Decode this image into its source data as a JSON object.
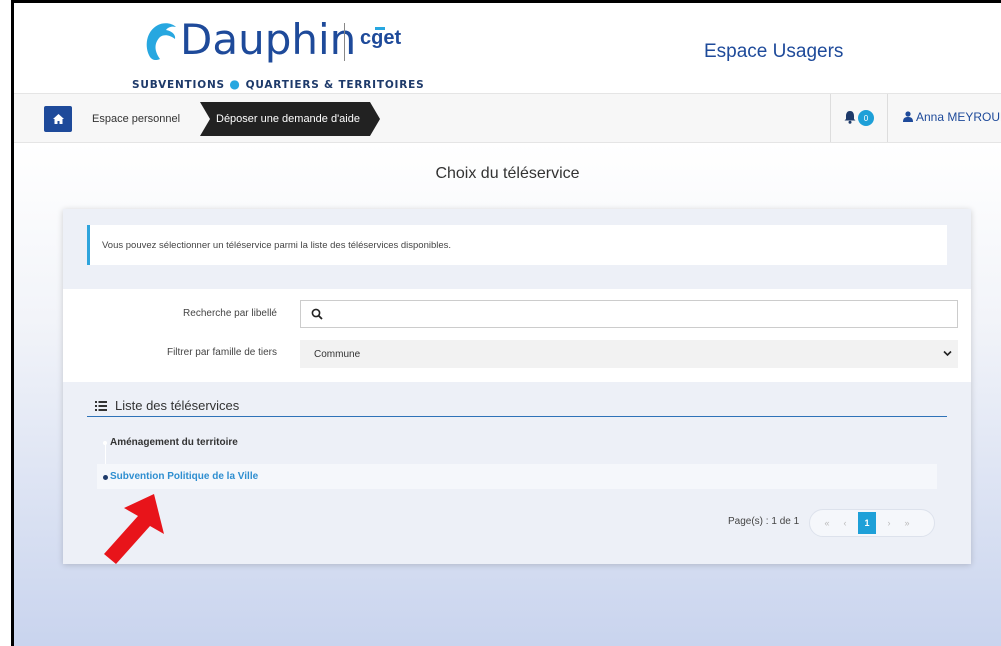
{
  "header": {
    "logo_text": "Dauphin",
    "logo_partner": "cget",
    "tagline_left": "SUBVENTIONS",
    "tagline_right": "QUARTIERS & TERRITOIRES",
    "space_title": "Espace Usagers"
  },
  "nav": {
    "home_icon": "home-icon",
    "breadcrumb_1": "Espace personnel",
    "breadcrumb_2": "Déposer une demande d'aide",
    "notification_count": "0",
    "user_name": "Anna MEYROUN"
  },
  "main": {
    "title": "Choix du téléservice",
    "info_text": "Vous pouvez sélectionner un téléservice parmi la liste des téléservices disponibles.",
    "search_label": "Recherche par libellé",
    "search_value": "",
    "filter_label": "Filtrer par famille de tiers",
    "filter_value": "Commune",
    "list_title": "Liste des téléservices",
    "items": [
      {
        "label": "Aménagement du territoire"
      },
      {
        "label": "Subvention Politique de la Ville"
      }
    ],
    "pager_label": "Page(s) : 1 de 1",
    "pager_first": "«",
    "pager_prev": "‹",
    "pager_current": "1",
    "pager_next": "›",
    "pager_last": "»"
  },
  "colors": {
    "brand_blue": "#1e4a9a",
    "accent_cyan": "#1ea0d8",
    "annotation_red": "#e8141a"
  }
}
